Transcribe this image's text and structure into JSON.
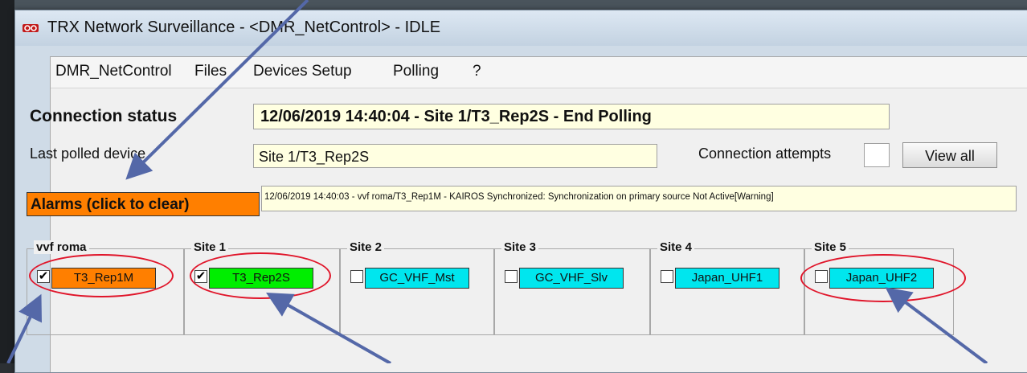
{
  "window": {
    "title": "TRX Network Surveillance - <DMR_NetControl> - IDLE"
  },
  "menu": {
    "items": [
      "DMR_NetControl",
      "Files",
      "Devices Setup",
      "Polling",
      "?"
    ]
  },
  "connection_status": {
    "label": "Connection status",
    "value": "12/06/2019 14:40:04 - Site 1/T3_Rep2S - End Polling"
  },
  "last_polled": {
    "label": "Last polled device",
    "value": "Site 1/T3_Rep2S"
  },
  "connection_attempts": {
    "label": "Connection attempts",
    "value": ""
  },
  "view_all": {
    "label": "View all"
  },
  "alarms": {
    "label": "Alarms (click to clear)",
    "message": "12/06/2019 14:40:03 - vvf roma/T3_Rep1M - KAIROS Synchronized: Synchronization on primary source Not Active[Warning]",
    "color": "#ff7f00"
  },
  "sites": [
    {
      "name": "vvf roma",
      "device": "T3_Rep1M",
      "checked": true,
      "color": "#ff7f00"
    },
    {
      "name": "Site 1",
      "device": "T3_Rep2S",
      "checked": true,
      "color": "#00ee00"
    },
    {
      "name": "Site 2",
      "device": "GC_VHF_Mst",
      "checked": false,
      "color": "#00e6ee"
    },
    {
      "name": "Site 3",
      "device": "GC_VHF_Slv",
      "checked": false,
      "color": "#00e6ee"
    },
    {
      "name": "Site 4",
      "device": "Japan_UHF1",
      "checked": false,
      "color": "#00e6ee"
    },
    {
      "name": "Site 5",
      "device": "Japan_UHF2",
      "checked": false,
      "color": "#00e6ee"
    }
  ],
  "annotations": {
    "arrow_color": "#5468a8",
    "ring_color": "#e0152a"
  }
}
